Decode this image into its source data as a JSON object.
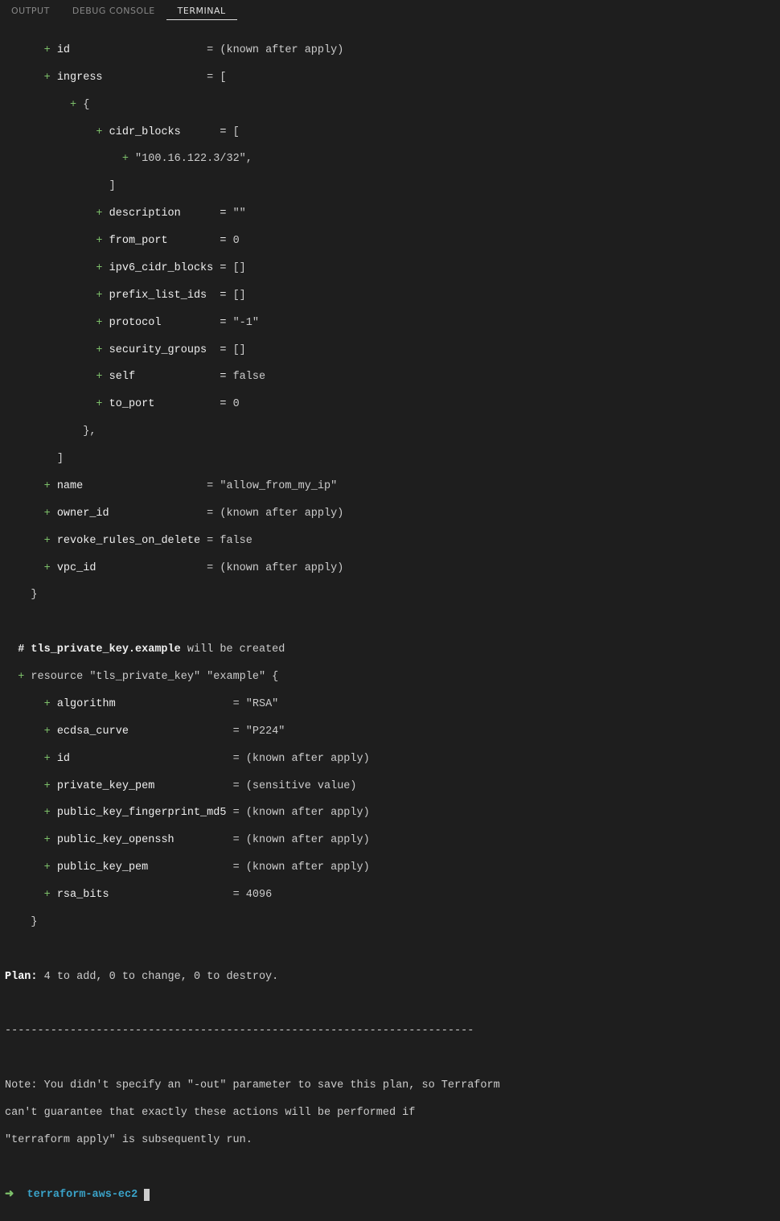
{
  "tabs": {
    "output": "OUTPUT",
    "debug_console": "DEBUG CONSOLE",
    "terminal": "TERMINAL"
  },
  "plus": "+",
  "sg": {
    "id_key": "id",
    "id_val": "= (known after apply)",
    "ingress_key": "ingress",
    "ingress_val": "= [",
    "open_brace": "{",
    "cidr_key": "cidr_blocks      = ",
    "cidr_open": "[",
    "cidr_val": "\"100.16.122.3/32\",",
    "cidr_close": "]",
    "desc_key": "description      = ",
    "desc_val": "\"\"",
    "from_port_key": "from_port        = ",
    "from_port_val": "0",
    "ipv6_key": "ipv6_cidr_blocks = ",
    "ipv6_val": "[]",
    "prefix_key": "prefix_list_ids  = ",
    "prefix_val": "[]",
    "protocol_key": "protocol         = ",
    "protocol_val": "\"-1\"",
    "secgrp_key": "security_groups  = ",
    "secgrp_val": "[]",
    "self_key": "self             = ",
    "self_val": "false",
    "to_port_key": "to_port          = ",
    "to_port_val": "0",
    "close_brace_comma": "},",
    "close_bracket": "]",
    "name_key": "name",
    "name_val": "= \"allow_from_my_ip\"",
    "owner_key": "owner_id",
    "owner_val": "= (known after apply)",
    "revoke_key": "revoke_rules_on_delete",
    "revoke_val": "= false",
    "vpc_key": "vpc_id",
    "vpc_val": "= (known after apply)",
    "final_close": "}"
  },
  "tls": {
    "comment_prefix": "# ",
    "comment_name": "tls_private_key.example",
    "comment_suffix": " will be created",
    "resource_line": "resource \"tls_private_key\" \"example\" {",
    "algo_key": "algorithm",
    "algo_val": "= \"RSA\"",
    "curve_key": "ecdsa_curve",
    "curve_val": "= \"P224\"",
    "id_key": "id",
    "id_val": "= (known after apply)",
    "pem_key": "private_key_pem",
    "pem_val": "= (sensitive value)",
    "fp_key": "public_key_fingerprint_md5",
    "fp_val": "= (known after apply)",
    "ssh_key": "public_key_openssh",
    "ssh_val": "= (known after apply)",
    "pub_key": "public_key_pem",
    "pub_val": "= (known after apply)",
    "rsa_key": "rsa_bits",
    "rsa_val": "= 4096",
    "close": "}"
  },
  "plan": {
    "label": "Plan:",
    "text": " 4 to add, 0 to change, 0 to destroy."
  },
  "divider": "------------------------------------------------------------------------",
  "note": {
    "line1": "Note: You didn't specify an \"-out\" parameter to save this plan, so Terraform",
    "line2": "can't guarantee that exactly these actions will be performed if",
    "line3": "\"terraform apply\" is subsequently run."
  },
  "prompt": {
    "arrow": "➜",
    "path": "terraform-aws-ec2"
  }
}
